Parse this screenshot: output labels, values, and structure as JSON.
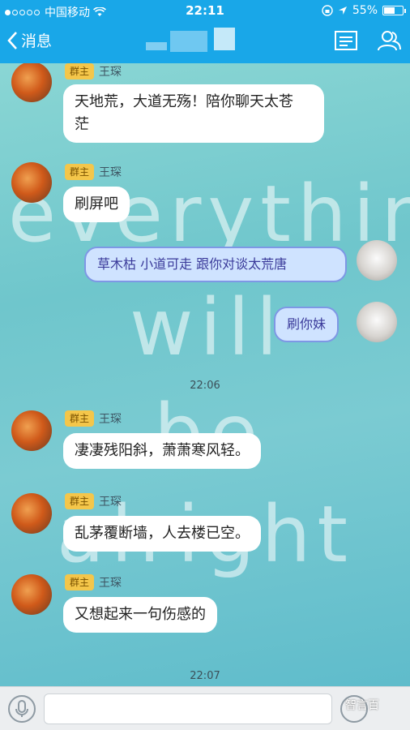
{
  "status": {
    "carrier": "中国移动",
    "time": "22:11",
    "battery": "55%",
    "signal_dots_filled": 1,
    "signal_dots_total": 5
  },
  "nav": {
    "back_label": "消息"
  },
  "messages": [
    {
      "sender": "王琛",
      "badge": "群主",
      "text_line1": "天地荒，大道无殇！陪你聊天太苍",
      "text_line2": "茫"
    },
    {
      "sender": "王琛",
      "badge": "群主",
      "text": "刷屏吧"
    },
    {
      "text": "草木枯 小道可走  跟你对谈太荒唐"
    },
    {
      "text": "刷你妹"
    },
    {
      "timestamp": "22:06"
    },
    {
      "sender": "王琛",
      "badge": "群主",
      "text": "凄凄残阳斜，萧萧寒风轻。"
    },
    {
      "sender": "王琛",
      "badge": "群主",
      "text": "乱茅覆断墙，人去楼已空。"
    },
    {
      "sender": "王琛",
      "badge": "群主",
      "text": "又想起来一句伤感的"
    },
    {
      "timestamp": "22:07"
    }
  ],
  "background_text": [
    "everything",
    "will",
    "be",
    "alright"
  ],
  "watermark": "智言百",
  "colors": {
    "accent": "#19a7e8",
    "badge": "#f4c64a",
    "bubble_right_border": "#7e97e5"
  },
  "icons": [
    "wifi-icon",
    "location-icon",
    "lock-rotation-icon",
    "back-chevron-icon",
    "group-info-icon",
    "members-icon",
    "microphone-icon",
    "emoji-icon"
  ]
}
